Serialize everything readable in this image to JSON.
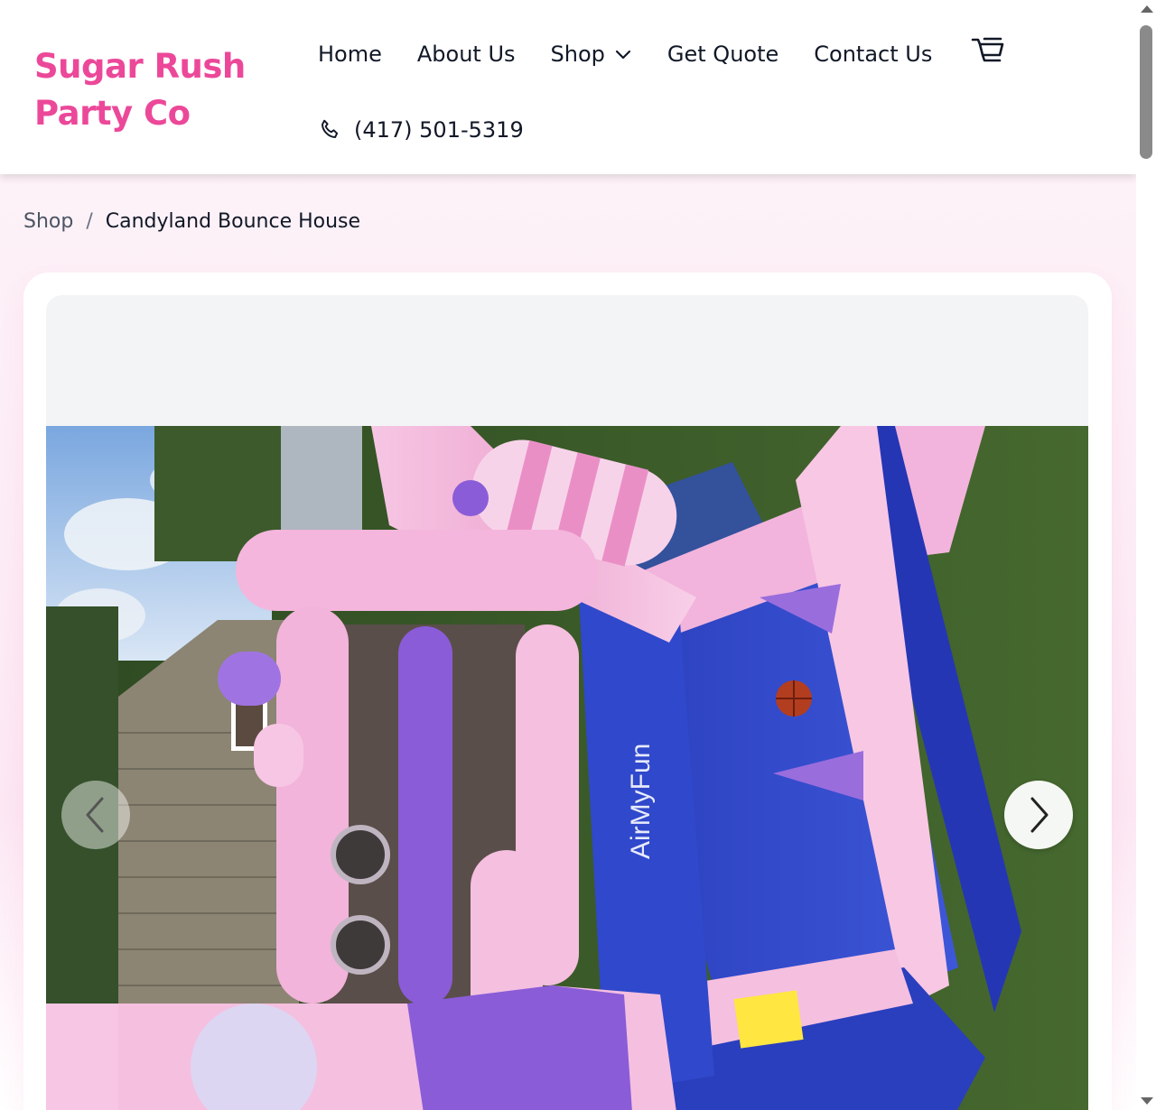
{
  "brand": {
    "name": "Sugar Rush Party Co"
  },
  "nav": {
    "items": [
      {
        "label": "Home"
      },
      {
        "label": "About Us"
      },
      {
        "label": "Shop"
      },
      {
        "label": "Get Quote"
      },
      {
        "label": "Contact Us"
      }
    ],
    "phone": "(417) 501-5319"
  },
  "breadcrumb": {
    "shop": "Shop",
    "separator": "/",
    "current": "Candyland Bounce House"
  },
  "product_image": {
    "brand_mark": "AirMyFun"
  },
  "colors": {
    "brand": "#ec4899",
    "text": "#111827",
    "gallery_bg": "#f3f4f6",
    "inflatable_pink": "#f4b8dc",
    "inflatable_purple": "#8a5cd8",
    "inflatable_blue": "#2f45c8"
  },
  "icons": [
    "cart-icon",
    "chevron-down-icon",
    "phone-icon",
    "chevron-left-icon",
    "chevron-right-icon"
  ]
}
